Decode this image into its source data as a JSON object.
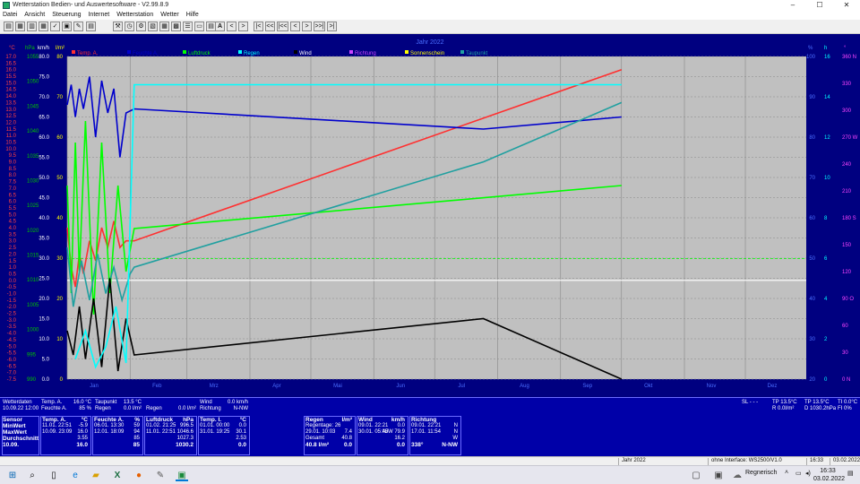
{
  "window": {
    "title": "Wetterstation Bedien- und Auswertesoftware - V2.99.8.9",
    "minimize": "–",
    "maximize": "☐",
    "close": "✕"
  },
  "menu": [
    "Datei",
    "Ansicht",
    "Steuerung",
    "Internet",
    "Wetterstation",
    "Wetter",
    "Hilfe"
  ],
  "toolbar": {
    "text_button": "A",
    "nav": [
      "<",
      ">",
      "|<",
      "<<",
      "|<<",
      "<",
      ">",
      ">>|",
      ">|"
    ]
  },
  "chart": {
    "title": "Jahr 2022",
    "legend": [
      {
        "name": "Temp. A.",
        "color": "#ff3030"
      },
      {
        "name": "Feuchte A.",
        "color": "#0000cc"
      },
      {
        "name": "Luftdruck",
        "color": "#00ff00"
      },
      {
        "name": "Regen",
        "color": "#00ffff"
      },
      {
        "name": "Wind",
        "color": "#000000"
      },
      {
        "name": "Richtung",
        "color": "#cc44ff"
      },
      {
        "name": "Sonnenschein",
        "color": "#ffff00"
      },
      {
        "name": "Taupunkt",
        "color": "#20a0a0"
      }
    ],
    "axis_units": {
      "temp": "°C",
      "pressure": "hPa",
      "wind": "km/h",
      "rain": "l/m²",
      "humidity": "%",
      "sun": "h",
      "direction": "°"
    },
    "temp_ticks": [
      "17.0",
      "16.5",
      "16.0",
      "15.5",
      "15.0",
      "14.5",
      "14.0",
      "13.5",
      "13.0",
      "12.5",
      "12.0",
      "11.5",
      "11.0",
      "10.5",
      "10.0",
      "9.5",
      "9.0",
      "8.5",
      "8.0",
      "7.5",
      "7.0",
      "6.5",
      "6.0",
      "5.5",
      "5.0",
      "4.5",
      "4.0",
      "3.5",
      "3.0",
      "2.5",
      "2.0",
      "1.5",
      "1.0",
      "0.5",
      "0.0",
      "-0.5",
      "-1.0",
      "-1.5",
      "-2.0",
      "-2.5",
      "-3.0",
      "-3.5",
      "-4.0",
      "-4.5",
      "-5.0",
      "-5.5",
      "-6.0",
      "-6.5",
      "-7.0",
      "-7.5"
    ],
    "pressure_ticks": [
      "1055",
      "1050",
      "1045",
      "1040",
      "1035",
      "1030",
      "1025",
      "1020",
      "1015",
      "1010",
      "1005",
      "1000",
      "995",
      "990"
    ],
    "wind_ticks": [
      "80.0",
      "75.0",
      "70.0",
      "65.0",
      "60.0",
      "55.0",
      "50.0",
      "45.0",
      "40.0",
      "35.0",
      "30.0",
      "25.0",
      "20.0",
      "15.0",
      "10.0",
      "5.0",
      "0.0"
    ],
    "rain_ticks": [
      "80",
      "70",
      "60",
      "50",
      "40",
      "30",
      "20",
      "10",
      "0"
    ],
    "humidity_ticks": [
      "100",
      "90",
      "80",
      "70",
      "60",
      "50",
      "40",
      "30",
      "20"
    ],
    "sun_ticks": [
      "16",
      "14",
      "12",
      "10",
      "8",
      "6",
      "4",
      "2",
      "0"
    ],
    "direction_ticks": [
      "360 N",
      "330",
      "300",
      "270 W",
      "240",
      "210",
      "180 S",
      "150",
      "120",
      "90 O",
      "60",
      "30",
      "0 N"
    ],
    "month_ticks": [
      "Jan",
      "Feb",
      "Mrz",
      "Apr",
      "Mai",
      "Jun",
      "Jul",
      "Aug",
      "Sep",
      "Okt",
      "Nov",
      "Dez"
    ]
  },
  "chart_data": {
    "type": "line",
    "title": "Jahr 2022",
    "x_type": "date",
    "xlim": [
      "2022-01-01",
      "2022-12-31"
    ],
    "series": [
      {
        "name": "Temp. A.",
        "unit": "°C",
        "color": "#ff3030",
        "points": [
          [
            "2022-01-01",
            4.0
          ],
          [
            "2022-01-03",
            1.0
          ],
          [
            "2022-01-05",
            -0.5
          ],
          [
            "2022-01-07",
            2.0
          ],
          [
            "2022-01-09",
            0.5
          ],
          [
            "2022-01-12",
            3.0
          ],
          [
            "2022-01-15",
            1.5
          ],
          [
            "2022-01-18",
            4.0
          ],
          [
            "2022-01-21",
            2.5
          ],
          [
            "2022-01-24",
            4.5
          ],
          [
            "2022-01-27",
            2.5
          ],
          [
            "2022-01-30",
            3.0
          ],
          [
            "2022-02-03",
            3.0
          ],
          [
            "2022-10-01",
            16.0
          ]
        ]
      },
      {
        "name": "Feuchte A.",
        "unit": "%",
        "color": "#0000cc",
        "points": [
          [
            "2022-01-01",
            88
          ],
          [
            "2022-01-03",
            93
          ],
          [
            "2022-01-05",
            85
          ],
          [
            "2022-01-07",
            92
          ],
          [
            "2022-01-09",
            87
          ],
          [
            "2022-01-12",
            95
          ],
          [
            "2022-01-15",
            80
          ],
          [
            "2022-01-18",
            94
          ],
          [
            "2022-01-21",
            86
          ],
          [
            "2022-01-24",
            92
          ],
          [
            "2022-01-27",
            75
          ],
          [
            "2022-01-30",
            86
          ],
          [
            "2022-02-03",
            87
          ],
          [
            "2022-07-25",
            82
          ],
          [
            "2022-10-01",
            85
          ]
        ]
      },
      {
        "name": "Luftdruck",
        "unit": "hPa",
        "color": "#00ff00",
        "points": [
          [
            "2022-01-01",
            1030
          ],
          [
            "2022-01-03",
            1005
          ],
          [
            "2022-01-05",
            1040
          ],
          [
            "2022-01-07",
            1010
          ],
          [
            "2022-01-10",
            1045
          ],
          [
            "2022-01-14",
            1000
          ],
          [
            "2022-01-18",
            1040
          ],
          [
            "2022-01-22",
            1005
          ],
          [
            "2022-01-26",
            1030
          ],
          [
            "2022-01-30",
            1010
          ],
          [
            "2022-02-03",
            1020
          ],
          [
            "2022-10-01",
            1030
          ]
        ]
      },
      {
        "name": "Taupunkt",
        "unit": "°C",
        "color": "#20a0a0",
        "points": [
          [
            "2022-01-01",
            2.5
          ],
          [
            "2022-01-04",
            -2.0
          ],
          [
            "2022-01-08",
            1.5
          ],
          [
            "2022-01-12",
            -1.5
          ],
          [
            "2022-01-16",
            2.0
          ],
          [
            "2022-01-20",
            -1.0
          ],
          [
            "2022-01-24",
            1.0
          ],
          [
            "2022-01-28",
            -1.5
          ],
          [
            "2022-02-01",
            0.5
          ],
          [
            "2022-02-03",
            1.0
          ],
          [
            "2022-07-25",
            9.0
          ],
          [
            "2022-10-01",
            13.5
          ]
        ]
      },
      {
        "name": "Wind",
        "unit": "km/h",
        "color": "#000000",
        "points": [
          [
            "2022-01-01",
            12
          ],
          [
            "2022-01-04",
            6
          ],
          [
            "2022-01-07",
            18
          ],
          [
            "2022-01-10",
            5
          ],
          [
            "2022-01-14",
            20
          ],
          [
            "2022-01-18",
            3
          ],
          [
            "2022-01-22",
            25
          ],
          [
            "2022-01-26",
            2
          ],
          [
            "2022-01-30",
            15
          ],
          [
            "2022-02-03",
            6
          ],
          [
            "2022-07-25",
            15
          ],
          [
            "2022-10-01",
            0
          ]
        ]
      },
      {
        "name": "Regen",
        "unit": "l/m²",
        "color": "#00ffff",
        "points": [
          [
            "2022-01-05",
            5
          ],
          [
            "2022-01-10",
            12
          ],
          [
            "2022-01-15",
            3
          ],
          [
            "2022-01-20",
            8
          ],
          [
            "2022-01-25",
            18
          ],
          [
            "2022-01-30",
            4
          ],
          [
            "2022-02-03",
            73
          ],
          [
            "2022-10-01",
            73
          ]
        ]
      }
    ],
    "reference_lines": [
      {
        "unit": "°C",
        "value": 0.0,
        "color": "#ffffff"
      },
      {
        "unit": "hPa",
        "value": 1013,
        "color": "#00ff00",
        "style": "dashed"
      }
    ],
    "grid": true,
    "legend": "top"
  },
  "current": {
    "wetterdaten_label": "Wetterdaten",
    "datetime": "10.09.22 12:00",
    "temp_label": "Temp. A.",
    "temp_value": "16.0 °C",
    "hum_label": "Feuchte A.",
    "hum_value": "85 %",
    "dew_label": "Taupunkt",
    "dew_value": "13.5 °C",
    "rain_label": "Regen",
    "rain_value": "0.0 l/m²",
    "rain2_label": "Regen",
    "rain2_value": "0.0 l/m²",
    "wind_label": "Wind",
    "wind_value": "0.0 km/h",
    "dir_label": "Richtung",
    "dir_value": "N-NW",
    "sl_label": "SL",
    "sl_value": "- - -",
    "tp_label": "TP 13.5°C",
    "rr_label": "R 0.0l/m²",
    "tp2_label": "TP 13.5°C",
    "dp_label": "D 1030.2hPa",
    "ti_label": "TI 0.0°C",
    "fi_label": "FI 0%"
  },
  "stats": {
    "sensor": {
      "title": "Sensor",
      "rows": [
        "MinWert",
        "MaxWert",
        "Durchschnitt",
        "10.09."
      ]
    },
    "temp": {
      "title": "Temp. A.",
      "unit": "°C",
      "rows": [
        [
          "11.01. 22:51",
          "-5.9"
        ],
        [
          "10.09. 23:09",
          "16.0"
        ],
        [
          "",
          "3.55"
        ],
        [
          "",
          "16.0"
        ]
      ]
    },
    "hum": {
      "title": "Feuchte A.",
      "unit": "%",
      "rows": [
        [
          "06.01. 13:30",
          "59"
        ],
        [
          "12.01. 18:09",
          "94"
        ],
        [
          "",
          "85"
        ],
        [
          "",
          "85"
        ]
      ]
    },
    "press": {
      "title": "Luftdruck",
      "unit": "hPa",
      "rows": [
        [
          "01.02. 21:25",
          "996.5"
        ],
        [
          "11.01. 22:51",
          "1046.6"
        ],
        [
          "",
          "1027.3"
        ],
        [
          "",
          "1030.2"
        ]
      ]
    },
    "tempi": {
      "title": "Temp. I.",
      "unit": "°C",
      "rows": [
        [
          "01.01. 00:00",
          "0.0"
        ],
        [
          "31.01. 19:25",
          "30.1"
        ],
        [
          "",
          "2.53"
        ],
        [
          "",
          "0.0"
        ]
      ]
    },
    "rain": {
      "title": "Regen",
      "unit": "l/m²",
      "rows": [
        [
          "Regentage: 26",
          ""
        ],
        [
          "29.01. 10:03",
          "7.4"
        ],
        [
          "Gesamt",
          "40.8"
        ],
        [
          "40.8 l/m²",
          "0.0"
        ]
      ]
    },
    "wind": {
      "title": "Wind",
      "unit": "km/h",
      "rows": [
        [
          "09.01. 22:21",
          "0.0"
        ],
        [
          "30.01. 05:45",
          "N/W 79.9"
        ],
        [
          "",
          "16.2"
        ],
        [
          "",
          "0.0"
        ]
      ]
    },
    "dir": {
      "title": "Richtung",
      "unit": "",
      "rows": [
        [
          "09.01. 22:21",
          "N"
        ],
        [
          "17.01. 11:54",
          "N"
        ],
        [
          "",
          "W"
        ],
        [
          "338°",
          "N-NW"
        ]
      ]
    }
  },
  "status": {
    "period": "Jahr 2022",
    "interface": "ohne Interface: WS2500/V1.0",
    "time": "16:33",
    "date": "03.02.2022"
  },
  "taskbar": {
    "weather": "Regnerisch",
    "time": "16:33",
    "date": "03.02.2022"
  }
}
